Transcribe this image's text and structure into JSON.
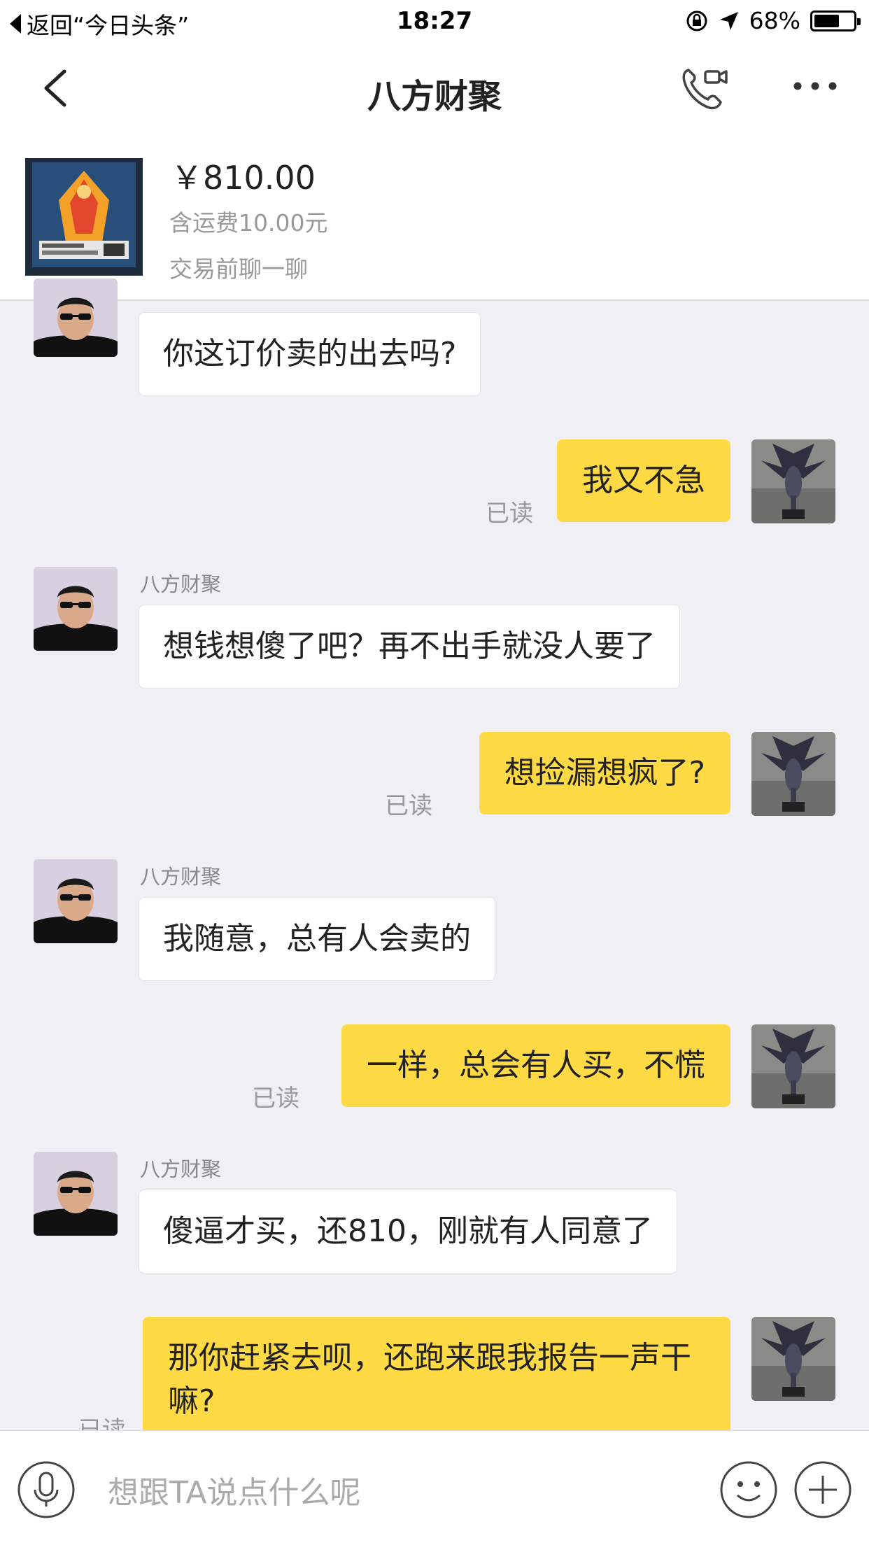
{
  "status_bar": {
    "back_text": "返回“今日头条”",
    "time": "18:27",
    "battery_percent": "68%",
    "battery_level": 0.68
  },
  "nav": {
    "title": "八方财聚",
    "back_icon": "chevron-left-icon",
    "call_icon": "phone-video-icon",
    "more_icon": "more-icon"
  },
  "product": {
    "price": "￥810.00",
    "shipping": "含运费10.00元",
    "hint": "交易前聊一聊"
  },
  "messages": [
    {
      "side": "in",
      "sender": "",
      "text": "你这订价卖的出去吗?"
    },
    {
      "side": "out",
      "text": "我又不急",
      "read": "已读"
    },
    {
      "side": "in",
      "sender": "八方财聚",
      "text": "想钱想傻了吧？再不出手就没人要了"
    },
    {
      "side": "out",
      "text": "想捡漏想疯了?",
      "read": "已读"
    },
    {
      "side": "in",
      "sender": "八方财聚",
      "text": "我随意，总有人会卖的"
    },
    {
      "side": "out",
      "text": "一样，总会有人买，不慌",
      "read": "已读"
    },
    {
      "side": "in",
      "sender": "八方财聚",
      "text": "傻逼才买，还810，刚就有人同意了"
    },
    {
      "side": "out",
      "text": "那你赶紧去呗，还跑来跟我报告一声干嘛?",
      "read": "已读"
    }
  ],
  "input": {
    "placeholder": "想跟TA说点什么呢"
  },
  "colors": {
    "outgoing_bubble": "#ffda44",
    "incoming_bubble": "#ffffff",
    "background": "#efeff4"
  }
}
